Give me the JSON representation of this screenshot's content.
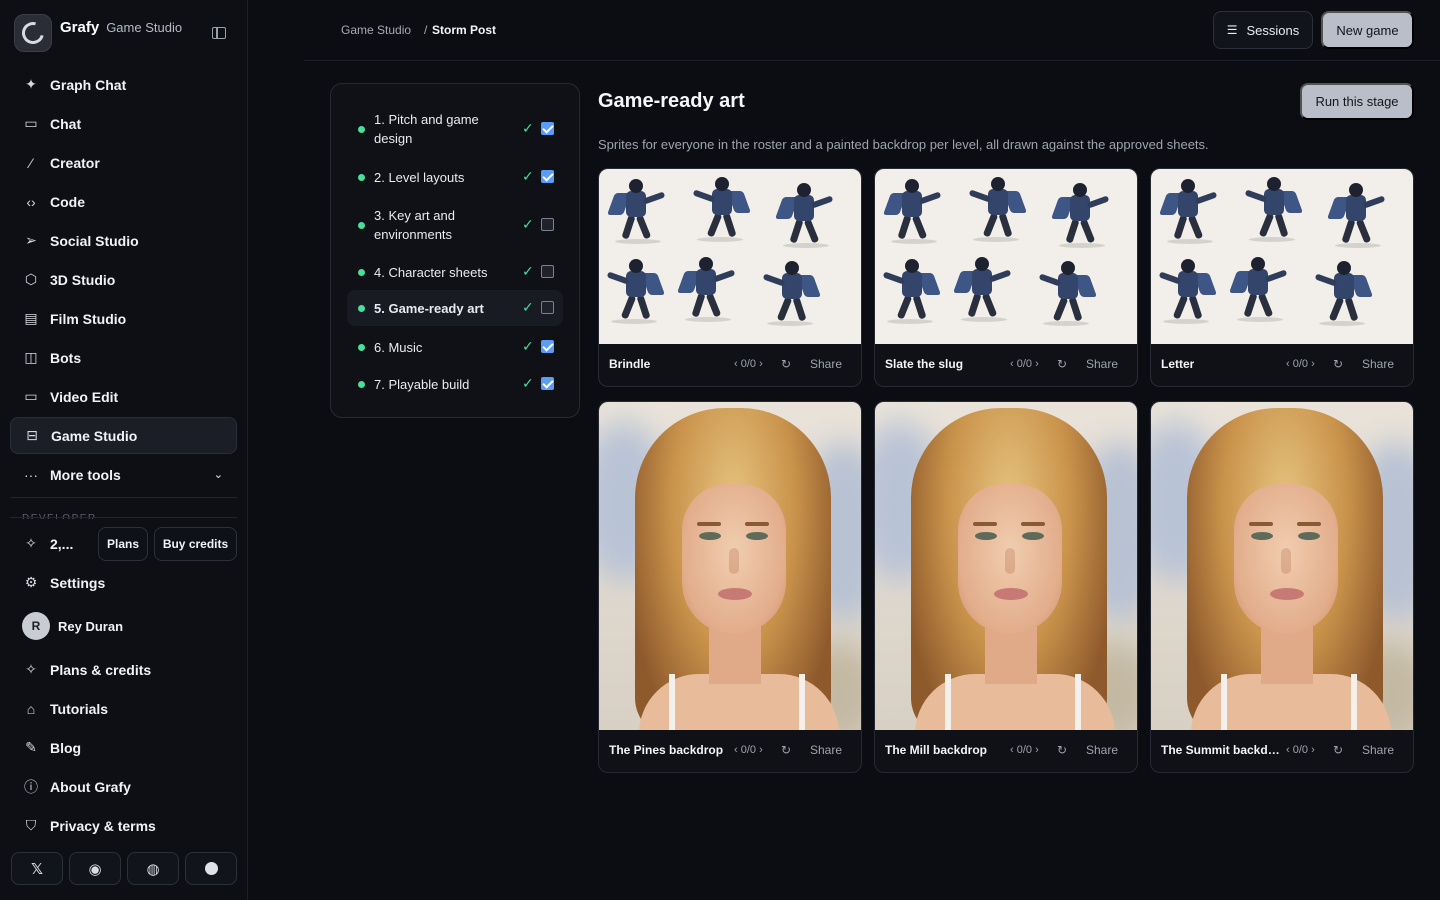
{
  "brand": {
    "name": "Grafy",
    "sub": "Game Studio"
  },
  "nav": [
    {
      "label": "Graph Chat",
      "icon": "sparkle-icon",
      "glyph": "✦"
    },
    {
      "label": "Chat",
      "icon": "chat-icon",
      "glyph": "▭"
    },
    {
      "label": "Creator",
      "icon": "wand-icon",
      "glyph": "⁄"
    },
    {
      "label": "Code",
      "icon": "code-icon",
      "glyph": "‹›"
    },
    {
      "label": "Social Studio",
      "icon": "send-icon",
      "glyph": "➢"
    },
    {
      "label": "3D Studio",
      "icon": "cube-icon",
      "glyph": "⬡"
    },
    {
      "label": "Film Studio",
      "icon": "film-icon",
      "glyph": "▤"
    },
    {
      "label": "Bots",
      "icon": "bot-icon",
      "glyph": "◫"
    },
    {
      "label": "Video Edit",
      "icon": "video-icon",
      "glyph": "▭"
    },
    {
      "label": "Game Studio",
      "icon": "gamepad-icon",
      "glyph": "⊟",
      "active": true
    },
    {
      "label": "More tools",
      "icon": "more-icon",
      "glyph": "···",
      "caret": "⌄"
    }
  ],
  "section_label": "DEVELOPER",
  "credits": {
    "count": "2,...",
    "plans_label": "Plans",
    "buy_label": "Buy credits"
  },
  "lower_nav": {
    "settings": "Settings",
    "user": {
      "initial": "R",
      "name": "Rey Duran"
    },
    "items": [
      {
        "label": "Plans & credits",
        "icon": "sparkle-icon",
        "glyph": "✧"
      },
      {
        "label": "Tutorials",
        "icon": "graduation-cap-icon",
        "glyph": "⌂"
      },
      {
        "label": "Blog",
        "icon": "pen-icon",
        "glyph": "✎"
      },
      {
        "label": "About Grafy",
        "icon": "info-icon",
        "glyph": "ⓘ"
      },
      {
        "label": "Privacy & terms",
        "icon": "shield-icon",
        "glyph": "⛉"
      }
    ]
  },
  "social": [
    {
      "icon": "x-icon",
      "glyph": "𝕏"
    },
    {
      "icon": "discord-icon",
      "glyph": "◉"
    },
    {
      "icon": "github-icon",
      "glyph": "◍"
    },
    {
      "icon": "dot-icon",
      "glyph": ""
    }
  ],
  "topbar": {
    "breadcrumb_root": "Game Studio",
    "breadcrumb_sep": "/",
    "breadcrumb_current": "Storm Post",
    "sessions_label": "Sessions",
    "new_game_label": "New game"
  },
  "stages": [
    {
      "label": "1. Pitch and game design",
      "checked": true
    },
    {
      "label": "2. Level layouts",
      "checked": true
    },
    {
      "label": "3. Key art and environments",
      "checked": false
    },
    {
      "label": "4. Character sheets",
      "checked": false
    },
    {
      "label": "5. Game-ready art",
      "checked": false,
      "active": true
    },
    {
      "label": "6. Music",
      "checked": true
    },
    {
      "label": "7. Playable build",
      "checked": true
    }
  ],
  "panel": {
    "title": "Game-ready art",
    "description": "Sprites for everyone in the roster and a painted backdrop per level, all drawn against the approved sheets.",
    "run_label": "Run this stage"
  },
  "cards": [
    {
      "name": "Brindle",
      "nav": "‹ 0/0 ›",
      "share": "Share",
      "kind": "sprite"
    },
    {
      "name": "Slate the slug",
      "nav": "‹ 0/0 ›",
      "share": "Share",
      "kind": "sprite"
    },
    {
      "name": "Letter",
      "nav": "‹ 0/0 ›",
      "share": "Share",
      "kind": "sprite"
    },
    {
      "name": "The Pines backdrop",
      "nav": "‹ 0/0 ›",
      "share": "Share",
      "kind": "portrait"
    },
    {
      "name": "The Mill backdrop",
      "nav": "‹ 0/0 ›",
      "share": "Share",
      "kind": "portrait"
    },
    {
      "name": "The Summit backdrop",
      "nav": "‹ 0/0 ›",
      "share": "Share",
      "kind": "portrait"
    }
  ]
}
